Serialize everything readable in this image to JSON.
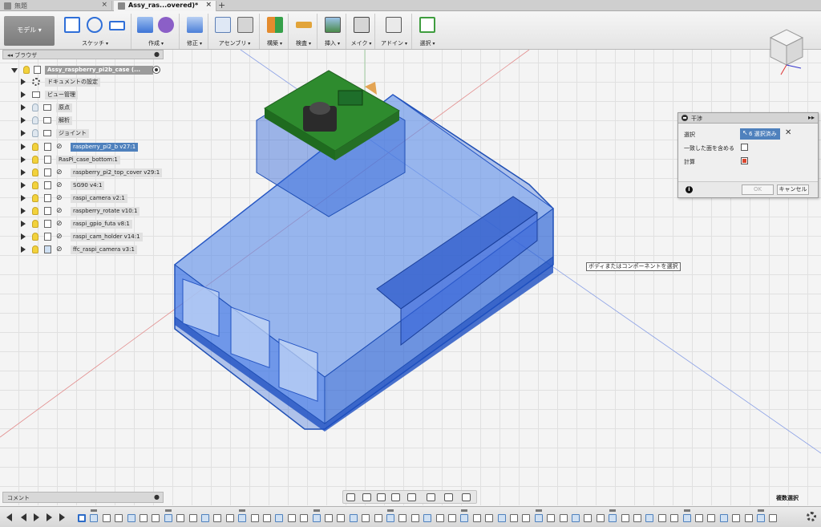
{
  "tabs": [
    {
      "label": "無題",
      "active": false
    },
    {
      "label": "Assy_ras...overed)*",
      "active": true
    }
  ],
  "toolbar": {
    "mode": "モデル ▾",
    "groups": [
      "スケッチ",
      "作成",
      "修正",
      "アセンブリ",
      "構築",
      "検査",
      "挿入",
      "メイク",
      "アドイン",
      "選択"
    ]
  },
  "browser": {
    "title": "ブラウザ",
    "root": "Assy_raspberry_pi2b_case (...",
    "nodes": [
      {
        "label": "ドキュメントの設定",
        "icon": "gear-icon"
      },
      {
        "label": "ビュー管理",
        "icon": "folder-icon"
      },
      {
        "label": "原点",
        "icon": "folder-icon"
      },
      {
        "label": "解析",
        "icon": "folder-icon"
      },
      {
        "label": "ジョイント",
        "icon": "folder-icon"
      },
      {
        "label": "raspberry_pi2_b v27:1",
        "icon": "link-icon",
        "selected": true
      },
      {
        "label": "RasPi_case_bottom:1",
        "icon": "box-icon"
      },
      {
        "label": "raspberry_pi2_top_cover v29:1",
        "icon": "link-icon"
      },
      {
        "label": "SG90 v4:1",
        "icon": "link-icon"
      },
      {
        "label": "raspi_camera v2:1",
        "icon": "link-icon"
      },
      {
        "label": "raspberry_rotate v10:1",
        "icon": "link-icon"
      },
      {
        "label": "raspi_gpio_futa v8:1",
        "icon": "link-icon"
      },
      {
        "label": "raspi_cam_holder v14:1",
        "icon": "link-icon"
      },
      {
        "label": "ffc_raspi_camera v3:1",
        "icon": "link-icon"
      }
    ]
  },
  "dialog": {
    "title": "干渉",
    "select_label": "選択",
    "select_value": "6 選択済み",
    "include_label": "一致した面を含める",
    "compute_label": "計算",
    "ok": "OK",
    "cancel": "キャンセル"
  },
  "tooltip": "ボディまたはコンポーネントを選択",
  "comment": "コメント",
  "status": "複数選択",
  "colors": {
    "selection": "#4f81bd",
    "model_blue": "#2f6fe0",
    "pcb_green": "#2e8b2e"
  }
}
